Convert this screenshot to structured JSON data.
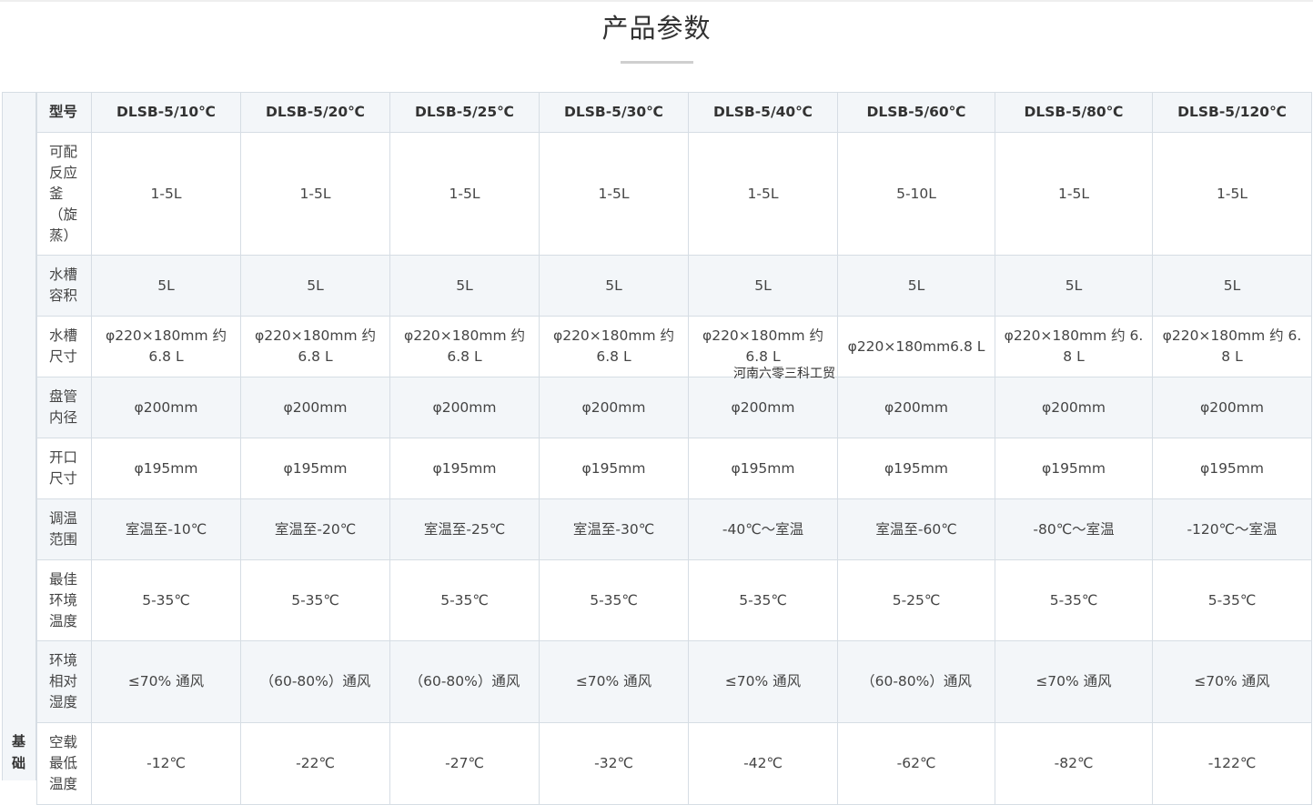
{
  "page": {
    "title": "产品参数",
    "watermark": "河南六零三科工贸"
  },
  "side": {
    "label": "基础"
  },
  "table": {
    "header": {
      "label": "型号",
      "models": [
        "DLSB-5/10℃",
        "DLSB-5/20℃",
        "DLSB-5/25℃",
        "DLSB-5/30℃",
        "DLSB-5/40℃",
        "DLSB-5/60℃",
        "DLSB-5/80℃",
        "DLSB-5/120℃"
      ]
    },
    "rows": [
      {
        "label": "可配反应釜（旋蒸）",
        "values": [
          "1-5L",
          "1-5L",
          "1-5L",
          "1-5L",
          "1-5L",
          "5-10L",
          "1-5L",
          "1-5L"
        ]
      },
      {
        "label": "水槽容积",
        "values": [
          "5L",
          "5L",
          "5L",
          "5L",
          "5L",
          "5L",
          "5L",
          "5L"
        ]
      },
      {
        "label": "水槽尺寸",
        "values": [
          "φ220×180mm 约 6.8 L",
          "φ220×180mm 约 6.8 L",
          "φ220×180mm 约 6.8 L",
          "φ220×180mm 约 6.8 L",
          "φ220×180mm 约 6.8 L",
          "φ220×180mm6.8 L",
          "φ220×180mm 约 6.8 L",
          "φ220×180mm 约 6.8 L"
        ]
      },
      {
        "label": "盘管内径",
        "values": [
          "φ200mm",
          "φ200mm",
          "φ200mm",
          "φ200mm",
          "φ200mm",
          "φ200mm",
          "φ200mm",
          "φ200mm"
        ]
      },
      {
        "label": "开口尺寸",
        "values": [
          "φ195mm",
          "φ195mm",
          "φ195mm",
          "φ195mm",
          "φ195mm",
          "φ195mm",
          "φ195mm",
          "φ195mm"
        ]
      },
      {
        "label": "调温范围",
        "values": [
          "室温至-10℃",
          "室温至-20℃",
          "室温至-25℃",
          "室温至-30℃",
          "-40℃～室温",
          "室温至-60℃",
          "-80℃～室温",
          "-120℃～室温"
        ]
      },
      {
        "label": "最佳环境温度",
        "values": [
          "5-35℃",
          "5-35℃",
          "5-35℃",
          "5-35℃",
          "5-35℃",
          "5-25℃",
          "5-35℃",
          "5-35℃"
        ]
      },
      {
        "label": "环境相对湿度",
        "values": [
          "≤70% 通风",
          "（60-80%）通风",
          "（60-80%）通风",
          "≤70% 通风",
          "≤70% 通风",
          "（60-80%）通风",
          "≤70% 通风",
          "≤70% 通风"
        ]
      },
      {
        "label": "空载最低温度",
        "values": [
          "-12℃",
          "-22℃",
          "-27℃",
          "-32℃",
          "-42℃",
          "-62℃",
          "-82℃",
          "-122℃"
        ]
      }
    ]
  }
}
